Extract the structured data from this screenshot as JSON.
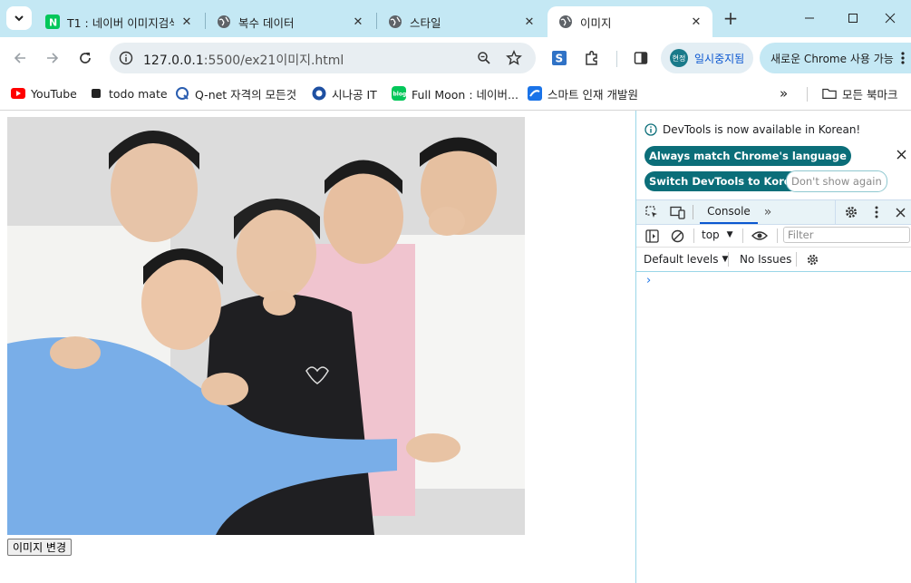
{
  "tabs": [
    {
      "title": "T1 : 네이버 이미지검색",
      "favicon": "naver-icon",
      "active": false
    },
    {
      "title": "복수 데이터",
      "favicon": "globe-icon",
      "active": false
    },
    {
      "title": "스타일",
      "favicon": "globe-icon",
      "active": false
    },
    {
      "title": "이미지",
      "favicon": "globe-icon",
      "active": true
    }
  ],
  "toolbar": {
    "url_host": "127.0.0.1",
    "url_rest": ":5500/ex21이미지.html",
    "profile_badge": "현정",
    "profile_label": "일시중지됨",
    "update_label": "새로운 Chrome 사용 가능"
  },
  "bookmarks": [
    {
      "label": "YouTube",
      "icon": "youtube-icon",
      "color": "#ff0000"
    },
    {
      "label": "todo mate",
      "icon": "todomate-icon",
      "color": "#222222"
    },
    {
      "label": "Q-net 자격의 모든것",
      "icon": "qnet-icon",
      "color": "#2a5db0"
    },
    {
      "label": "시나공 IT",
      "icon": "sinagong-icon",
      "color": "#1e50a2"
    },
    {
      "label": "Full Moon : 네이버...",
      "icon": "blog-icon",
      "color": "#03c75a"
    },
    {
      "label": "스마트 인재 개발원",
      "icon": "smart-icon",
      "color": "#1a73e8"
    }
  ],
  "bookmarks_folder": "모든 북마크",
  "page": {
    "button_label": "이미지 변경"
  },
  "devtools": {
    "info": "DevTools is now available in Korean!",
    "btn_match": "Always match Chrome's language",
    "btn_switch": "Switch DevTools to Korean",
    "btn_dont": "Don't show again",
    "tab_console": "Console",
    "context": "top",
    "filter_placeholder": "Filter",
    "levels": "Default levels",
    "issues": "No Issues",
    "accent": "#0b6e79"
  }
}
